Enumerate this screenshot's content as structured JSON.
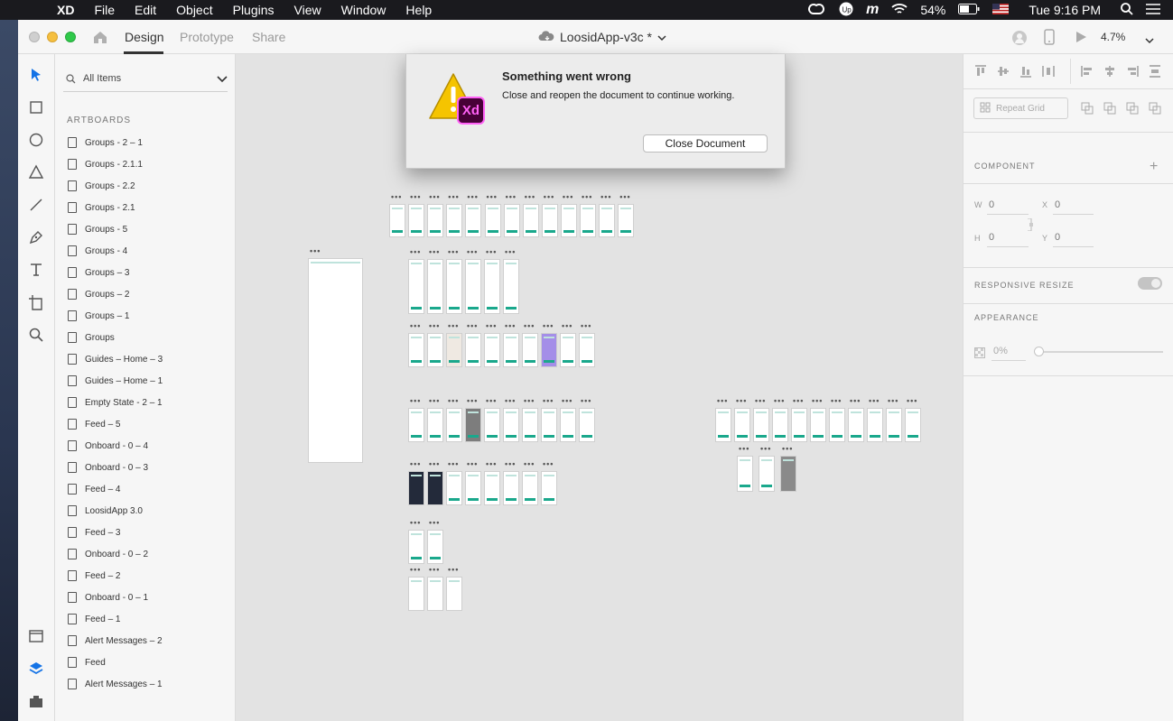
{
  "menubar": {
    "app": "XD",
    "items": [
      "File",
      "Edit",
      "Object",
      "Plugins",
      "View",
      "Window",
      "Help"
    ],
    "battery": "54%",
    "clock": "Tue 9:16 PM"
  },
  "titlebar": {
    "tabs": [
      "Design",
      "Prototype",
      "Share"
    ],
    "active_tab": "Design",
    "document_title": "LoosidApp-v3c *",
    "zoom": "4.7%"
  },
  "layers": {
    "filter": "All Items",
    "section": "ARTBOARDS",
    "items": [
      "Groups - 2 – 1",
      "Groups - 2.1.1",
      "Groups - 2.2",
      "Groups - 2.1",
      "Groups - 5",
      "Groups - 4",
      "Groups – 3",
      "Groups – 2",
      "Groups – 1",
      "Groups",
      "Guides – Home – 3",
      "Guides – Home – 1",
      "Empty State  - 2 – 1",
      "Feed – 5",
      "Onboard - 0 – 4",
      "Onboard - 0 – 3",
      "Feed – 4",
      "LoosidApp 3.0",
      "Feed – 3",
      "Onboard - 0 – 2",
      "Feed – 2",
      "Onboard - 0 – 1",
      "Feed – 1",
      "Alert Messages – 2",
      "Feed",
      "Alert Messages – 1"
    ]
  },
  "dialog": {
    "title": "Something went wrong",
    "message": "Close and reopen the document to continue working.",
    "button": "Close Document",
    "badge": "Xd"
  },
  "properties": {
    "repeat_grid": "Repeat Grid",
    "component": "COMPONENT",
    "w_label": "W",
    "w_value": "0",
    "x_label": "X",
    "x_value": "0",
    "h_label": "H",
    "h_value": "0",
    "y_label": "Y",
    "y_value": "0",
    "responsive_resize": "RESPONSIVE RESIZE",
    "appearance": "APPEARANCE",
    "opacity": "0%"
  },
  "colors": {
    "accent": "#1aa88c",
    "xd_pink": "#ff61f6",
    "xd_dark": "#470137",
    "warning": "#f5c400"
  }
}
